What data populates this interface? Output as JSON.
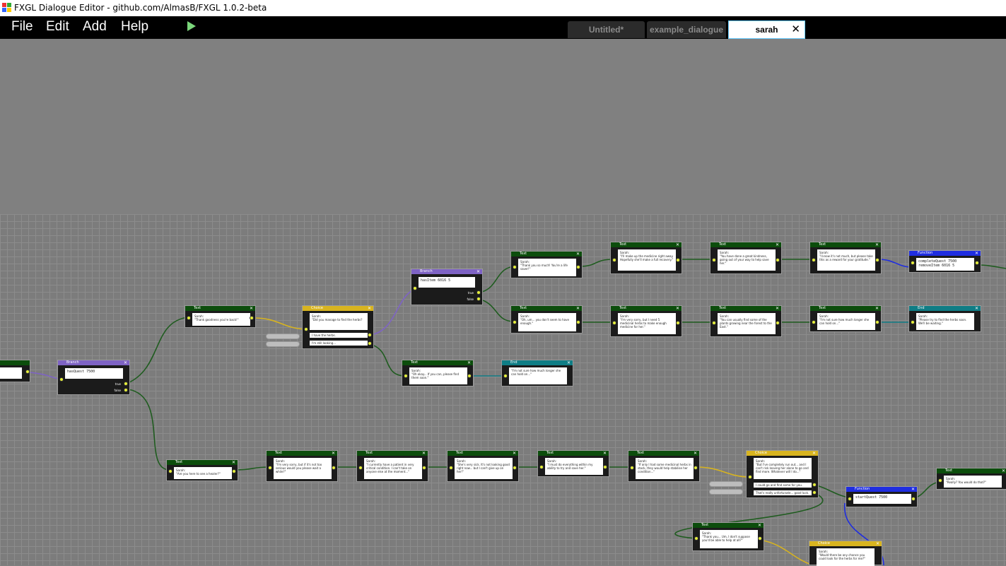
{
  "window": {
    "title": "FXGL Dialogue Editor - github.com/AlmasB/FXGL 1.0.2-beta"
  },
  "menu": {
    "file": "File",
    "edit": "Edit",
    "add": "Add",
    "help": "Help"
  },
  "tabs": [
    {
      "label": "Untitled*"
    },
    {
      "label": "example_dialogue"
    },
    {
      "label": "sarah",
      "close": "✕"
    }
  ],
  "colors": {
    "text_header": "#0c4d0c",
    "branch_header": "#7e63c4",
    "choice_header": "#d8b41f",
    "end_header": "#0f7d85",
    "function_header": "#1f2de0",
    "wire": "#1f5c1f"
  },
  "ports": {
    "true": "true",
    "false": "false"
  },
  "nodes": {
    "n_start": {
      "type": "",
      "text": ""
    },
    "n_branch1": {
      "type": "Branch",
      "text": "hasQuest 7500"
    },
    "n_text1": {
      "type": "Text",
      "text": "Sarah:\n\"Thank goodness you're back!\""
    },
    "n_choice1": {
      "type": "Choice",
      "text": "Sarah:\n\"Did you manage to find the herbs?",
      "options": [
        "I have the herbs.",
        "I'm still looking..."
      ]
    },
    "n_branch2": {
      "type": "Branch",
      "text": "hasItem 6016 5"
    },
    "n_text_oh": {
      "type": "Text",
      "text": "Sarah:\n\"Oh okay... If you can, please find them soon.\""
    },
    "n_end_mid": {
      "type": "End",
      "text": "\"I'm not sure how much longer she can hold on...\""
    },
    "n_text_ty": {
      "type": "Text",
      "text": "Sarah:\n\"Thank you so much! You're a life saver!\""
    },
    "n_text_med": {
      "type": "Text",
      "text": "Sarah:\n\"I'll make up the medicine right away. Hopefully she'll make a full recovery.\""
    },
    "n_text_kind": {
      "type": "Text",
      "text": "Sarah:\n\"You have done a great kindness, going out of your way to help save her.\""
    },
    "n_text_reward": {
      "type": "Text",
      "text": "Sarah:\n\"I know it's not much, but please take this as a reward for your gratitude.\""
    },
    "n_func1": {
      "type": "Function",
      "text": "completeQuest 7500\nremoveItem 6016 5"
    },
    "n_text_sorry": {
      "type": "Text",
      "text": "Sarah:\n\"Oh, um... you don't seem to have enough.\""
    },
    "n_text_need": {
      "type": "Text",
      "text": "Sarah:\n\"I'm very sorry, but I need 5 medicinal herbs to make enough medicine for her.\""
    },
    "n_text_find": {
      "type": "Text",
      "text": "Sarah:\n\"You can usually find some of the plants growing near the forest to the East.\""
    },
    "n_text_notsure": {
      "type": "Text",
      "text": "Sarah:\n\"I'm not sure how much longer she can hold on...\""
    },
    "n_end_top": {
      "type": "End",
      "text": "Sarah:\n\"Please try to find the herbs soon. We'll be waiting.\""
    },
    "n_text_healer": {
      "type": "Text",
      "text": "Sarah:\n\"Are you here to see a healer?\""
    },
    "n_text_b1": {
      "type": "Text",
      "text": "Sarah:\n\"I'm very sorry, but if it's not too serious would you please wait a while?\""
    },
    "n_text_b2": {
      "type": "Text",
      "text": "Sarah:\n\"I currently have a patient in very critical condition. I can't take on anyone else at the moment...\""
    },
    "n_text_b3": {
      "type": "Text",
      "text": "Sarah:\n\"She's very sick. It's not looking good right now... but I can't give up on her!\""
    },
    "n_text_b4": {
      "type": "Text",
      "text": "Sarah:\n\"I must do everything within my ability to try and save her.\""
    },
    "n_text_b5": {
      "type": "Text",
      "text": "Sarah:\n\"If only I had some medicinal herbs in stock, they would help stabilise her condition...\""
    },
    "n_choice2": {
      "type": "Choice",
      "text": "Sarah:\n\"But I've completely run out... and I can't risk leaving her alone to go and find more. Whatever will I do...\"",
      "options": [
        "I could go and find some for you.",
        "That's really unfortunate... good luck."
      ]
    },
    "n_func2": {
      "type": "Function",
      "text": "startQuest 7500"
    },
    "n_text_really": {
      "type": "Text",
      "text": "Sarah:\n\"Really? You would do that?\""
    },
    "n_text_thanku": {
      "type": "Text",
      "text": "Sarah:\n\"Thank you... Um, I don't suppose you'd be able to help at all?\""
    },
    "n_choice3": {
      "type": "Choice",
      "text": "Sarah:\n\"Would there be any chance you could look for the herbs for me?\""
    }
  }
}
